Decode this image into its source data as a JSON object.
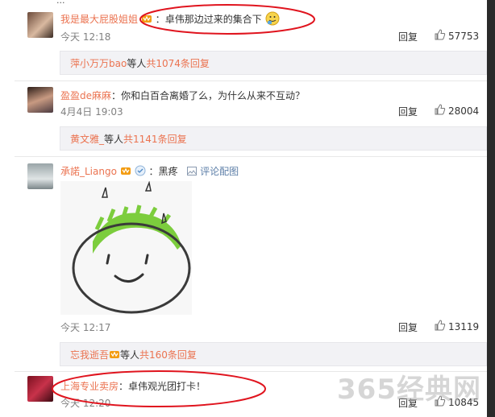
{
  "top_fragment": "...",
  "comments": [
    {
      "username": "我是最大屁股姐姐",
      "separator": "：",
      "text": "卓伟那边过来的集合下",
      "time": "今天 12:18",
      "reply_label": "回复",
      "likes": "57753",
      "sub": {
        "user": "萍小万万bao",
        "mid": " 等人 ",
        "count": "共1074条回复"
      }
    },
    {
      "username": "盈盈de麻麻",
      "separator": "：",
      "text": "你和白百合离婚了么，为什么从来不互动？",
      "time": "4月4日 19:03",
      "reply_label": "回复",
      "likes": "28004",
      "sub": {
        "user": "黄文雅_",
        "mid": " 等人 ",
        "count": "共1141条回复"
      }
    },
    {
      "username": "承諾_Liango",
      "separator": "：",
      "text": "黑疼",
      "pic_link": "评论配图",
      "time": "今天 12:17",
      "reply_label": "回复",
      "likes": "13119",
      "sub": {
        "user": "忘我逝吾",
        "mid": " 等人 ",
        "count": "共160条回复"
      }
    },
    {
      "username": "上海专业卖房",
      "separator": "：",
      "text": "卓伟观光团打卡！",
      "time": "今天 12:20",
      "reply_label": "回复",
      "likes": "10845"
    }
  ],
  "watermark": "365经典网",
  "colors": {
    "accent": "#eb7350",
    "annotation": "#e0141e",
    "sub_bg": "#f2f2f5"
  }
}
